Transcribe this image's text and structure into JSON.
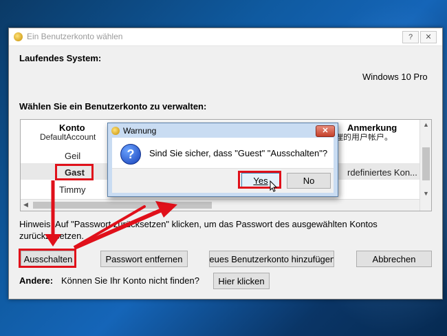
{
  "window": {
    "title": "Ein Benutzerkonto wählen",
    "help_label": "?",
    "close_label": "✕"
  },
  "running_system": {
    "label": "Laufendes System:",
    "value": "Windows 10 Pro"
  },
  "choose_account": {
    "label": "Wählen Sie ein Benutzerkonto zu verwalten:"
  },
  "list": {
    "columns": [
      "Konto",
      "Anmerkung"
    ],
    "rows": [
      {
        "account": "DefaultAccount",
        "note": "统管理的用户帐户。"
      },
      {
        "account": "Geil",
        "note": ""
      },
      {
        "account": "Gast",
        "note": "rdefiniertes Kon..."
      },
      {
        "account": "Timmy",
        "note": ""
      }
    ],
    "selected_index": 2
  },
  "hint_text": "Hinweis: Auf \"Passwort zurücksetzen\" klicken, um das Passwort des ausgewählten Kontos zurückzusetzen.",
  "hint_line1": "Hinweis: Auf \"Passwort zurücksetzen\" klicken, um das Passwort des ausgewählten Kontos",
  "hint_line2": "zurückzusetzen.",
  "buttons": {
    "disable": "Ausschalten",
    "remove_password": "Passwort entfernen",
    "add_account": "Neues Benutzerkonto hinzufügen",
    "cancel": "Abbrechen",
    "click_here": "Hier klicken"
  },
  "other": {
    "label": "Andere:",
    "question": "Können Sie Ihr Konto nicht finden?"
  },
  "dialog": {
    "title": "Warnung",
    "message": "Sind Sie sicher, dass \"Guest\" \"Ausschalten\"?",
    "yes": "Yes",
    "no": "No",
    "close_label": "✕"
  },
  "colors": {
    "highlight_red": "#e0101a",
    "desktop_blue": "#0f5aa0"
  }
}
